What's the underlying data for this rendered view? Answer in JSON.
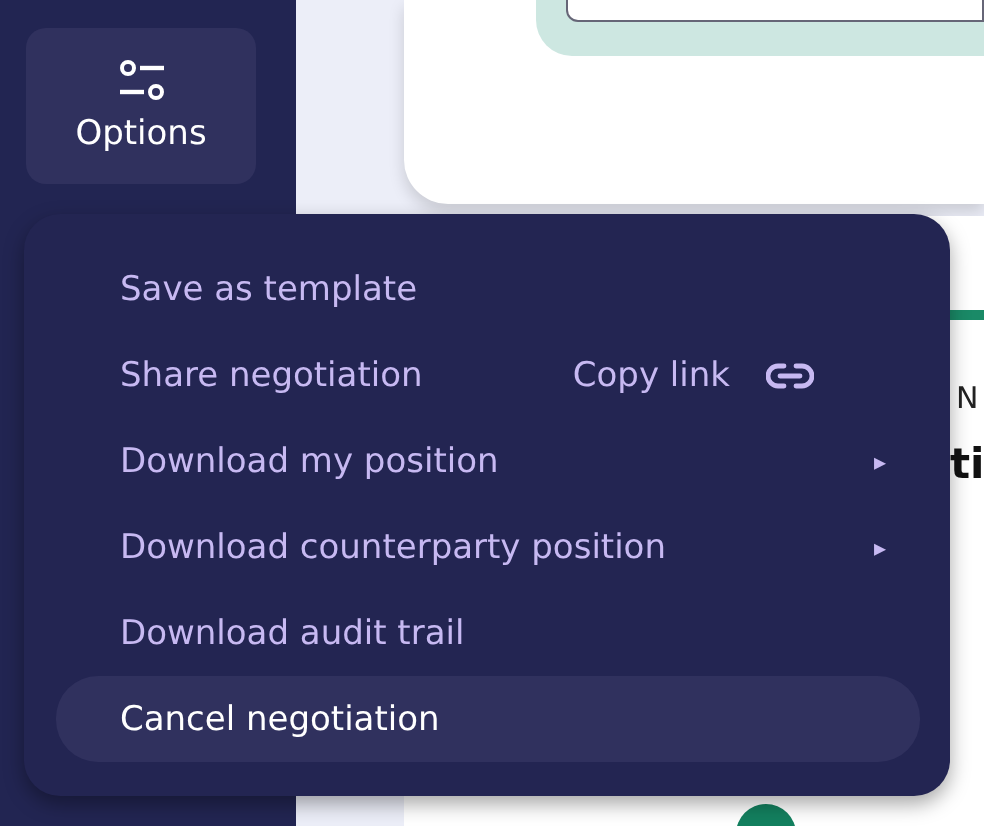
{
  "sidebar": {
    "options_button": {
      "label": "Options"
    }
  },
  "background_card": {
    "fragments": [
      "N",
      "ti"
    ]
  },
  "menu": {
    "items": [
      {
        "label": "Save as template",
        "kind": "plain",
        "selected": false
      },
      {
        "label": "Share negotiation",
        "kind": "share",
        "action": "Copy link",
        "selected": false
      },
      {
        "label": "Download my position",
        "kind": "submenu",
        "arrow": "▸",
        "selected": false
      },
      {
        "label": "Download counterparty position",
        "kind": "submenu",
        "arrow": "▸",
        "selected": false
      },
      {
        "label": "Download audit trail",
        "kind": "plain",
        "selected": false
      },
      {
        "label": "Cancel negotiation",
        "kind": "plain",
        "selected": true
      }
    ]
  }
}
